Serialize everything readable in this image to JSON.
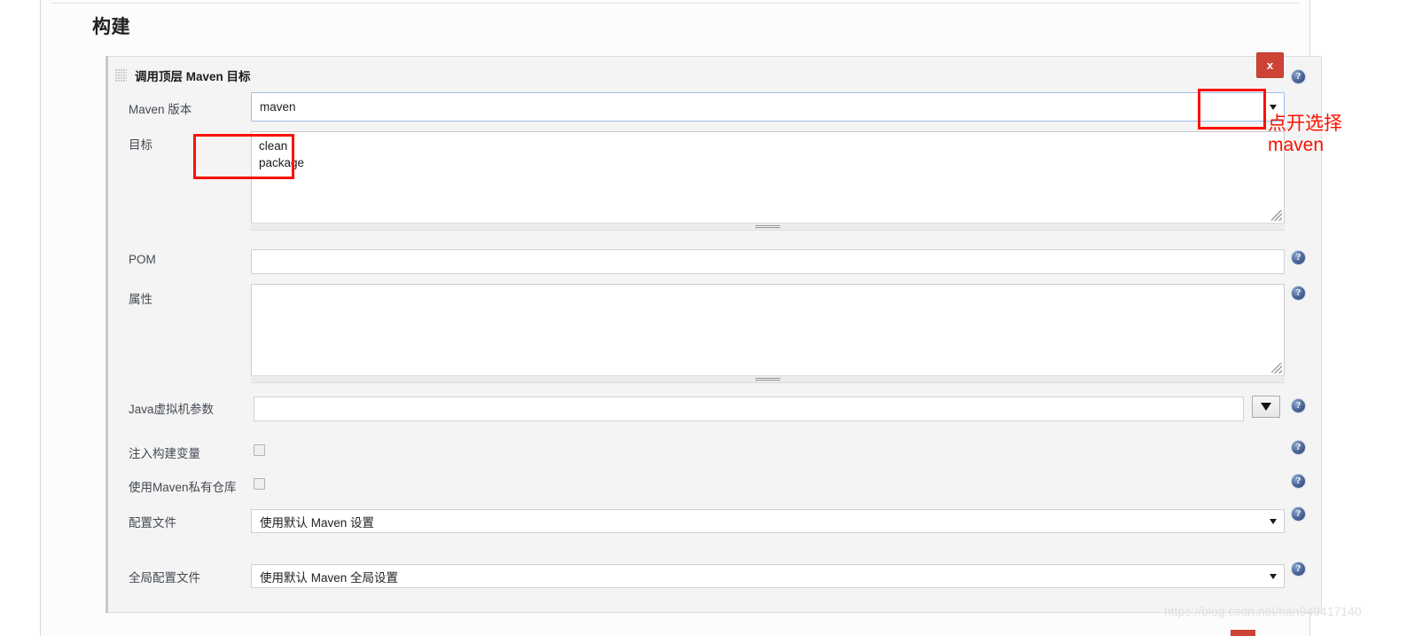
{
  "page": {
    "section_title": "构建",
    "watermark": "https://blog.csdn.net/han949417140"
  },
  "builder": {
    "title": "调用顶层 Maven 目标",
    "grip_icon": "drag-handle-icon",
    "delete_label": "x",
    "help_icon": "help-icon"
  },
  "fields": {
    "maven_version": {
      "label": "Maven 版本",
      "value": "maven",
      "options": [
        "maven"
      ]
    },
    "goals": {
      "label": "目标",
      "value": "clean\npackage",
      "placeholder": ""
    },
    "pom": {
      "label": "POM",
      "value": "",
      "placeholder": ""
    },
    "properties": {
      "label": "属性",
      "value": "",
      "placeholder": ""
    },
    "jvm_options": {
      "label": "Java虚拟机参数",
      "value": "",
      "placeholder": ""
    },
    "inject_build_vars": {
      "label": "注入构建变量",
      "checked": false
    },
    "use_private_repo": {
      "label": "使用Maven私有仓库",
      "checked": false
    },
    "settings_file": {
      "label": "配置文件",
      "value": "使用默认 Maven 设置",
      "options": [
        "使用默认 Maven 设置"
      ]
    },
    "global_settings_file": {
      "label": "全局配置文件",
      "value": "使用默认 Maven 全局设置",
      "options": [
        "使用默认 Maven 全局设置"
      ]
    }
  },
  "annotations": {
    "color": "#fb1100",
    "goals_box": "",
    "dropdown_box": "",
    "note_line1": "点开选择",
    "note_line2": "maven"
  }
}
